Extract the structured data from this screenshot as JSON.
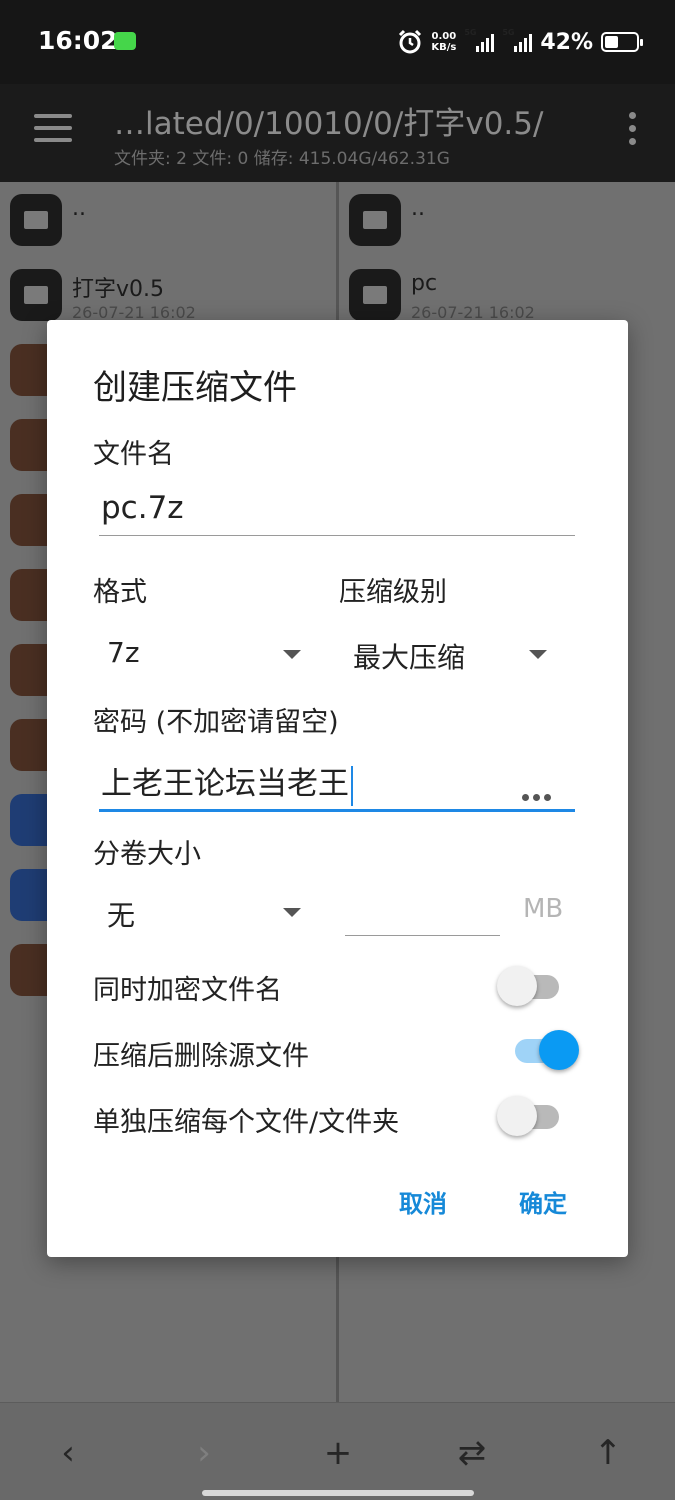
{
  "status_bar": {
    "time": "16:02",
    "speed_value": "0.00",
    "speed_unit": "KB/s",
    "signal1_label": "5G",
    "signal2_label": "5G",
    "battery_text": "42%",
    "battery_level": 0.42,
    "alarm_icon": "alarm-clock-icon"
  },
  "toolbar": {
    "path": "…lated/0/10010/0/打字v0.5/",
    "info": "文件夹: 2  文件: 0  储存: 415.04G/462.31G"
  },
  "left_pane": {
    "items": [
      {
        "name": "..",
        "date": "",
        "type": "folder"
      },
      {
        "name": "打字v0.5",
        "date": "26-07-21 16:02",
        "type": "folder"
      }
    ]
  },
  "right_pane": {
    "items": [
      {
        "name": "..",
        "date": "",
        "type": "folder"
      },
      {
        "name": "pc",
        "date": "26-07-21 16:02",
        "type": "folder"
      }
    ]
  },
  "dialog": {
    "title": "创建压缩文件",
    "filename_label": "文件名",
    "filename_value": "pc.7z",
    "format_label": "格式",
    "format_value": "7z",
    "level_label": "压缩级别",
    "level_value": "最大压缩",
    "password_label": "密码 (不加密请留空)",
    "password_value": "上老王论坛当老王",
    "volume_label": "分卷大小",
    "volume_value": "无",
    "volume_unit": "MB",
    "volume_size_value": "",
    "toggles": [
      {
        "label": "同时加密文件名",
        "on": false
      },
      {
        "label": "压缩后删除源文件",
        "on": true
      },
      {
        "label": "单独压缩每个文件/文件夹",
        "on": false
      }
    ],
    "cancel_label": "取消",
    "ok_label": "确定"
  },
  "colors": {
    "accent": "#1e88e5",
    "toggle_on": "#0a9af3",
    "button_text": "#1689d8"
  }
}
